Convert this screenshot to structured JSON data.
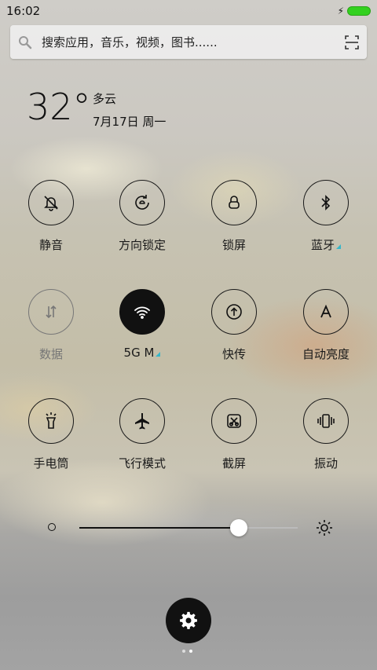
{
  "status": {
    "time": "16:02",
    "charging_icon": "lightning-icon",
    "battery_color": "#33d11f"
  },
  "search": {
    "placeholder": "搜索应用，音乐，视频，图书......",
    "scan_icon": "scan-icon"
  },
  "weather": {
    "temperature": "32°",
    "condition": "多云",
    "date": "7月17日 周一"
  },
  "toggles": [
    {
      "label": "静音",
      "icon": "bell-off-icon",
      "state": "off"
    },
    {
      "label": "方向锁定",
      "icon": "rotation-lock-icon",
      "state": "off"
    },
    {
      "label": "锁屏",
      "icon": "lock-icon",
      "state": "off"
    },
    {
      "label": "蓝牙",
      "icon": "bluetooth-icon",
      "state": "off"
    },
    {
      "label": "数据",
      "icon": "data-arrows-icon",
      "state": "disabled"
    },
    {
      "label": "5G M",
      "icon": "wifi-icon",
      "state": "on"
    },
    {
      "label": "快传",
      "icon": "transfer-icon",
      "state": "off"
    },
    {
      "label": "自动亮度",
      "icon": "auto-brightness-icon",
      "state": "off"
    },
    {
      "label": "手电筒",
      "icon": "flashlight-icon",
      "state": "off"
    },
    {
      "label": "飞行模式",
      "icon": "airplane-icon",
      "state": "off"
    },
    {
      "label": "截屏",
      "icon": "screenshot-icon",
      "state": "off"
    },
    {
      "label": "振动",
      "icon": "vibrate-icon",
      "state": "off"
    }
  ],
  "brightness": {
    "level": 0.73,
    "low_icon": "brightness-low-icon",
    "high_icon": "brightness-high-icon"
  },
  "settings": {
    "icon": "gear-icon"
  },
  "pages": {
    "count": 2,
    "current": 2
  }
}
